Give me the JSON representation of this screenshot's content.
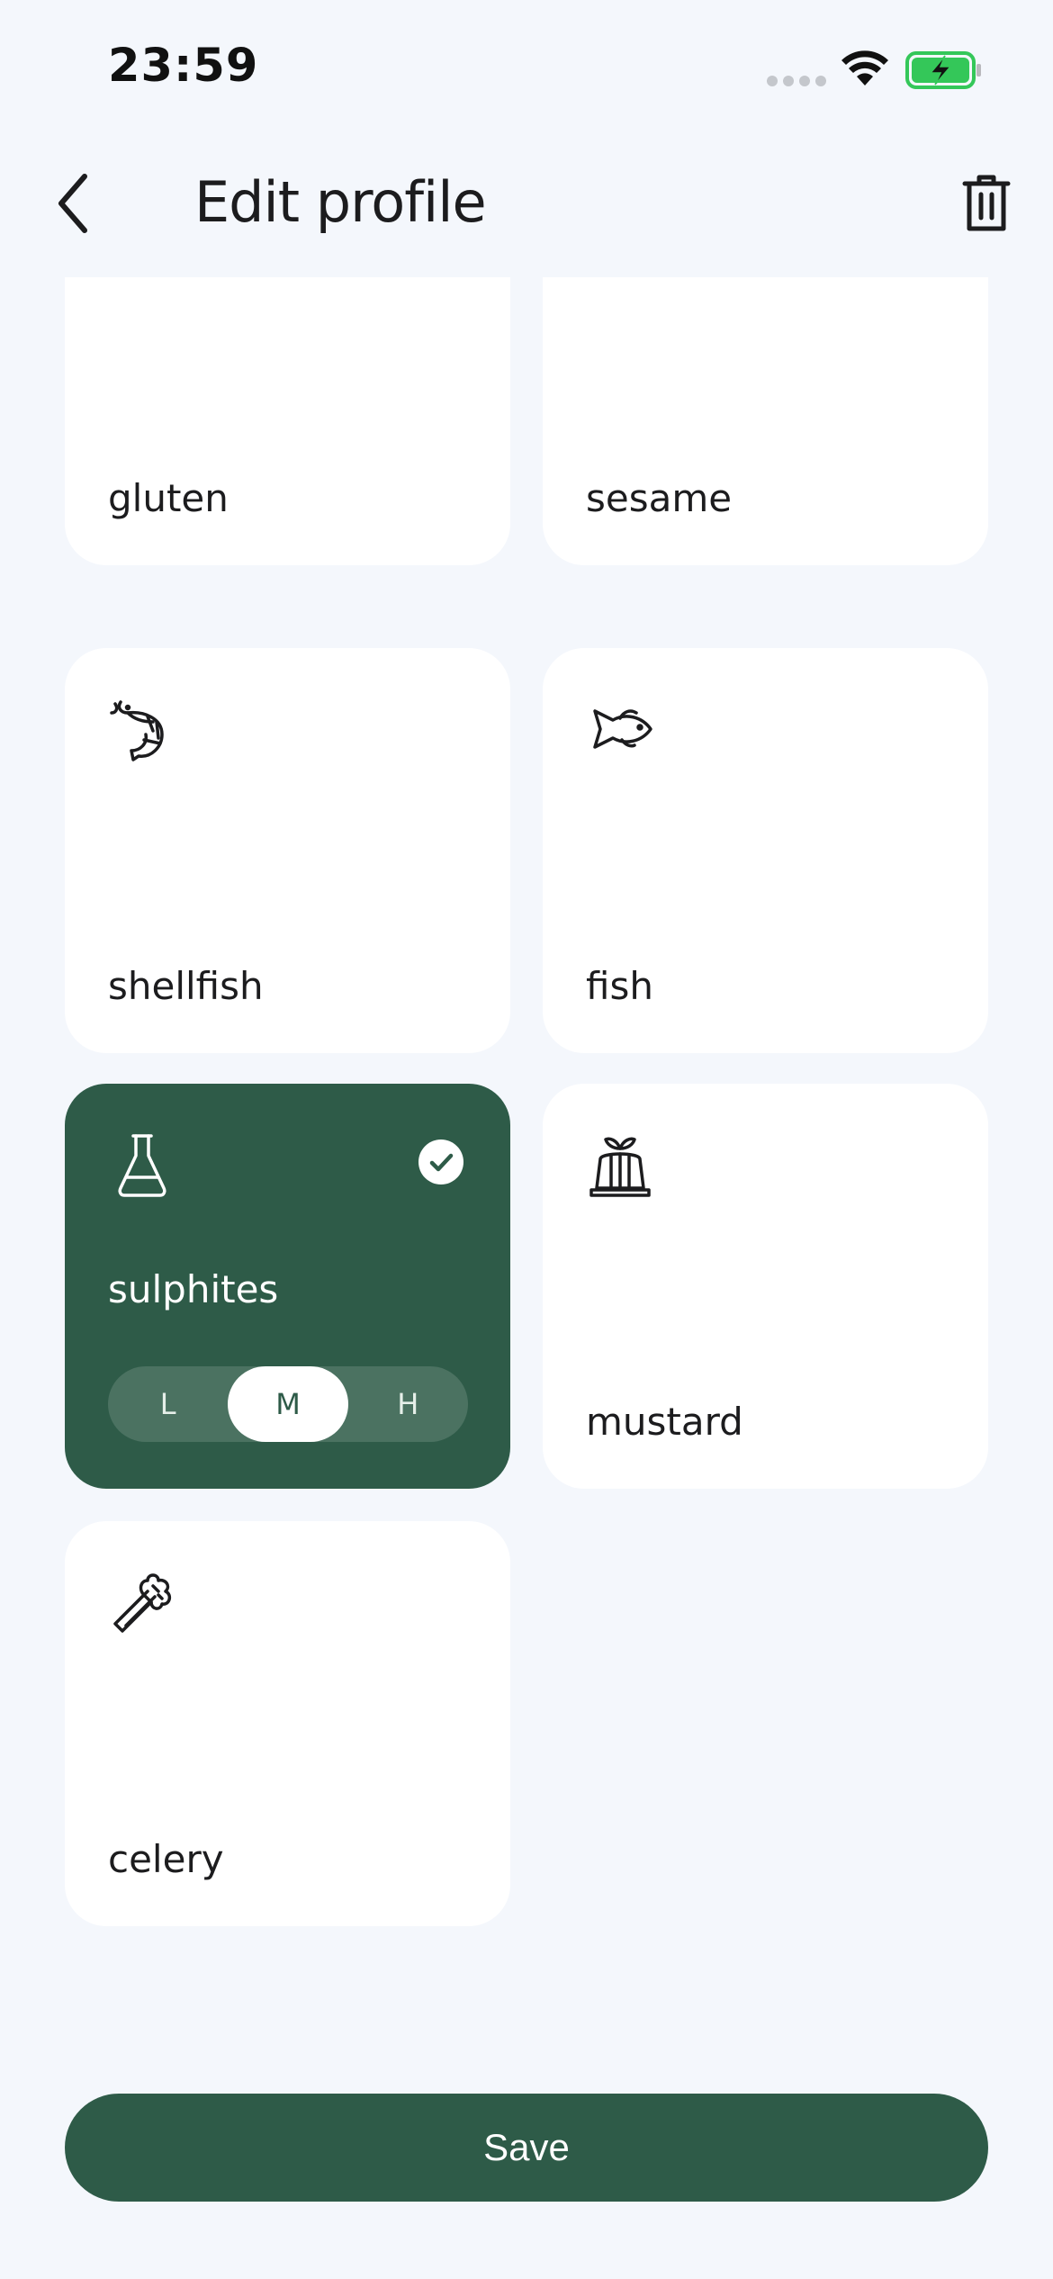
{
  "status_bar": {
    "time": "23:59"
  },
  "header": {
    "title": "Edit profile"
  },
  "allergens": [
    {
      "label": "gluten",
      "icon": "wheat-icon",
      "selected": false
    },
    {
      "label": "sesame",
      "icon": "seeds-icon",
      "selected": false
    },
    {
      "label": "shellfish",
      "icon": "shrimp-icon",
      "selected": false
    },
    {
      "label": "fish",
      "icon": "fish-icon",
      "selected": false
    },
    {
      "label": "sulphites",
      "icon": "flask-icon",
      "selected": true,
      "level_options": [
        "L",
        "M",
        "H"
      ],
      "level_selected": "M"
    },
    {
      "label": "mustard",
      "icon": "jelly-mold-icon",
      "selected": false
    },
    {
      "label": "celery",
      "icon": "celery-icon",
      "selected": false
    }
  ],
  "save_label": "Save",
  "colors": {
    "accent": "#2e5b48",
    "background": "#f4f7fc",
    "card": "#ffffff"
  }
}
